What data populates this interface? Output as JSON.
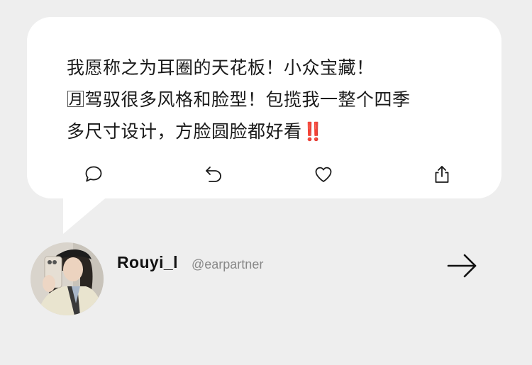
{
  "post": {
    "lines": [
      "我愿称之为耳圈的天花板！小众宝藏！",
      "🈷驾驭很多风格和脸型！包揽我一整个四季",
      "多尺寸设计，方脸圆脸都好看‼️"
    ]
  },
  "actions": {
    "icons": [
      "comment-icon",
      "reply-icon",
      "heart-icon",
      "share-icon"
    ]
  },
  "profile": {
    "username": "Rouyi_l",
    "handle": "@earpartner"
  },
  "colors": {
    "background": "#eeeeee",
    "bubble": "#ffffff",
    "text": "#1a1a1a",
    "handle": "#888888"
  }
}
